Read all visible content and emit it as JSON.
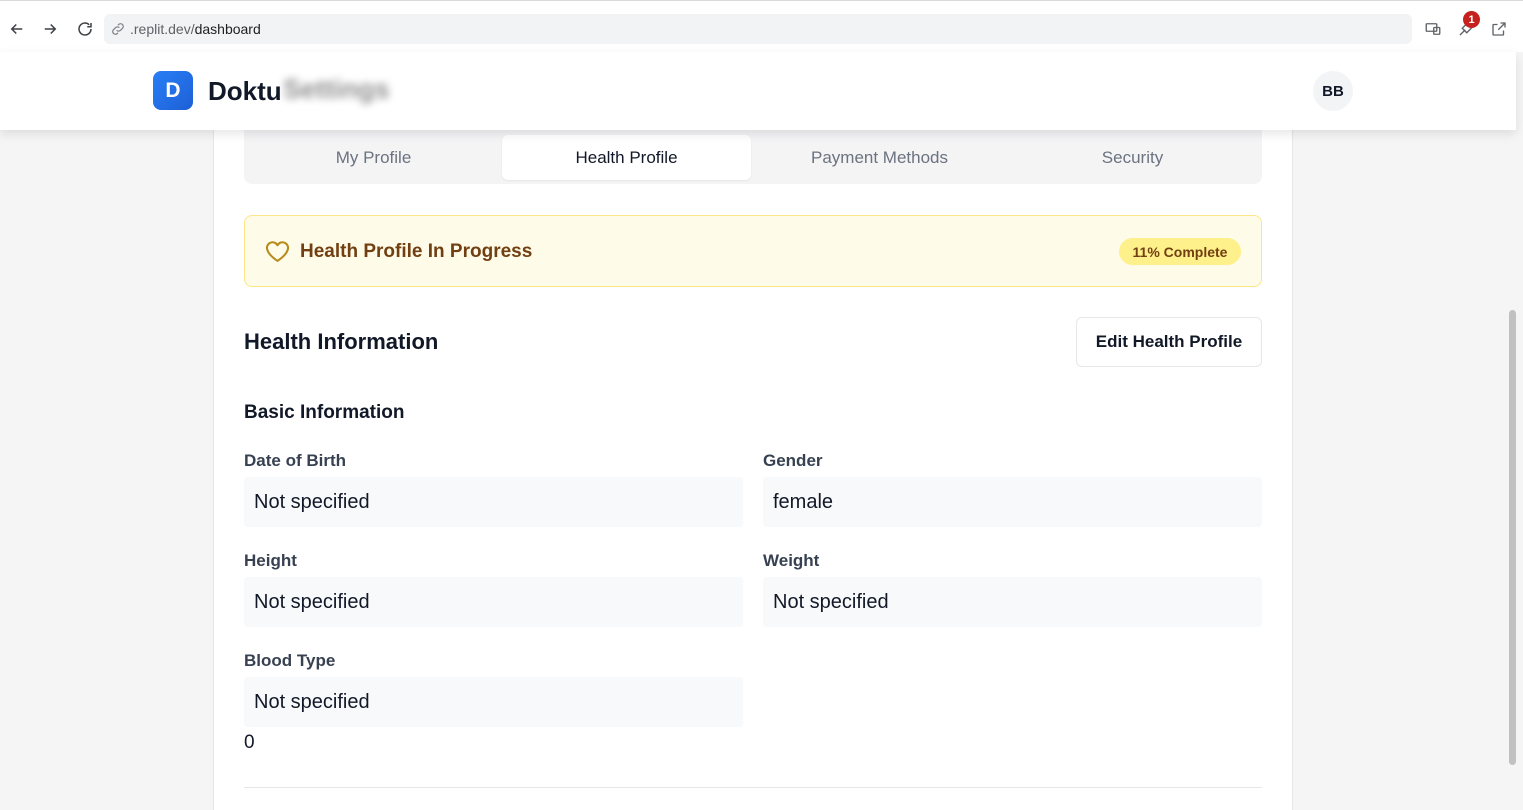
{
  "browser": {
    "url_host": ".replit.dev/",
    "url_path": "dashboard",
    "extension_badge": "1"
  },
  "header": {
    "logo_letter": "D",
    "brand": "Doktu",
    "blurred_title": "Settings",
    "avatar_initials": "BB"
  },
  "tabs": [
    {
      "label": "My Profile"
    },
    {
      "label": "Health Profile"
    },
    {
      "label": "Payment Methods"
    },
    {
      "label": "Security"
    }
  ],
  "banner": {
    "title": "Health Profile In Progress",
    "progress": "11% Complete",
    "progress_value": 0.11
  },
  "section": {
    "title": "Health Information",
    "edit_button": "Edit Health Profile",
    "subsection": "Basic Information"
  },
  "fields": {
    "dob": {
      "label": "Date of Birth",
      "value": "Not specified"
    },
    "gender": {
      "label": "Gender",
      "value": "female"
    },
    "height": {
      "label": "Height",
      "value": "Not specified"
    },
    "weight": {
      "label": "Weight",
      "value": "Not specified"
    },
    "blood_type": {
      "label": "Blood Type",
      "value": "Not specified"
    }
  },
  "extra_value": "0",
  "colors": {
    "accent": "#1d6fef",
    "banner_bg": "#fefce8",
    "banner_text": "#713f12"
  }
}
